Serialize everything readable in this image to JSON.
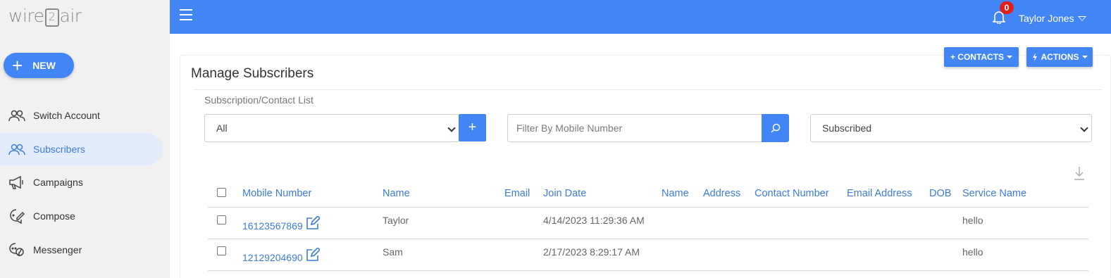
{
  "sidebar": {
    "logo": {
      "left": "wire",
      "mid": "2",
      "right": "air"
    },
    "new_label": "NEW",
    "items": [
      {
        "label": "Switch Account",
        "icon": "users-icon"
      },
      {
        "label": "Subscribers",
        "icon": "users-icon",
        "active": true
      },
      {
        "label": "Campaigns",
        "icon": "megaphone-icon"
      },
      {
        "label": "Compose",
        "icon": "compose-icon"
      },
      {
        "label": "Messenger",
        "icon": "chat-icon"
      }
    ]
  },
  "topbar": {
    "notification_count": "0",
    "user_name": "Taylor Jones"
  },
  "page": {
    "title": "Manage Subscribers",
    "contacts_label": "+ CONTACTS",
    "actions_label": "ACTIONS"
  },
  "filters": {
    "list_label": "Subscription/Contact List",
    "list_value": "All",
    "add_label": "+",
    "mobile_placeholder": "Filter By Mobile Number",
    "status_value": "Subscribed"
  },
  "table": {
    "headers": {
      "mobile": "Mobile Number",
      "name": "Name",
      "email": "Email",
      "join_date": "Join Date",
      "name2": "Name",
      "address": "Address",
      "contact_number": "Contact Number",
      "email_address": "Email Address",
      "dob": "DOB",
      "service_name": "Service Name"
    },
    "rows": [
      {
        "mobile": "16123567869",
        "name": "Taylor",
        "join_date": "4/14/2023 11:29:36 AM",
        "service": "hello"
      },
      {
        "mobile": "12129204690",
        "name": "Sam",
        "join_date": "2/17/2023 8:29:17 AM",
        "service": "hello"
      }
    ]
  },
  "colors": {
    "primary": "#4285f4",
    "link": "#3d7bdc",
    "badge": "#e0201c"
  }
}
